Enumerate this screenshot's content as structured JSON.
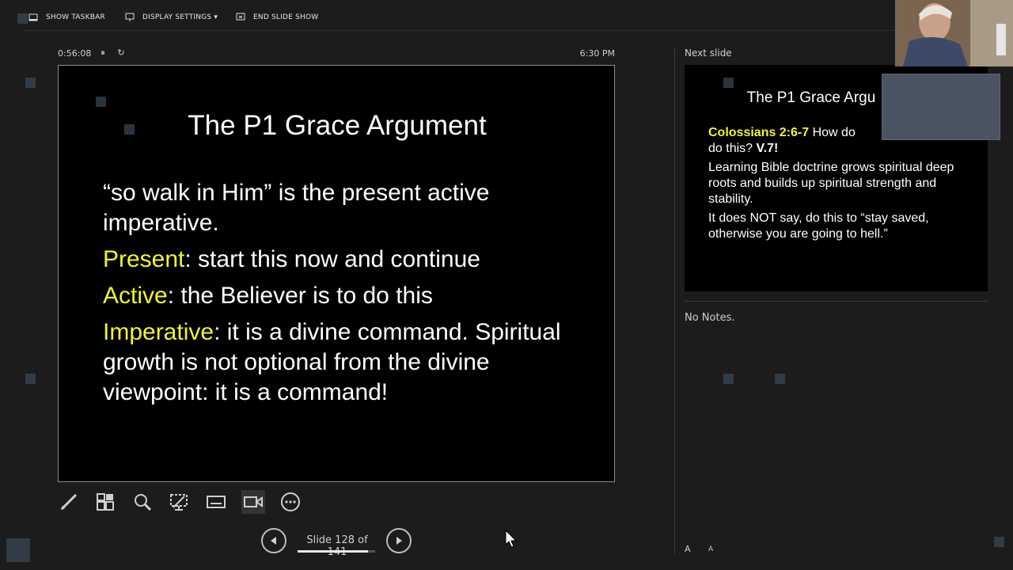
{
  "toolbar": {
    "show_taskbar": "SHOW TASKBAR",
    "display_settings": "DISPLAY SETTINGS ▾",
    "end_slide_show": "END SLIDE SHOW"
  },
  "timer": {
    "elapsed": "0:56:08",
    "pause_icon": "⏸",
    "reset_icon": "↻",
    "clock": "6:30 PM"
  },
  "current_slide": {
    "title": "The P1 Grace Argument",
    "intro": "“so walk in Him” is the present active imperative.",
    "present_term": "Present",
    "present_text": ": start this now and continue",
    "active_term": "Active",
    "active_text": ": the Believer is to do this",
    "imperative_term": "Imperative",
    "imperative_text": ": it is a divine command. Spiritual growth is not optional from the divine viewpoint: it is a command!"
  },
  "navigation": {
    "slide_counter": "Slide 128 of 141",
    "progress_fraction": 0.9078,
    "prev_icon": "◀",
    "next_icon": "▶"
  },
  "next_panel": {
    "label": "Next slide",
    "title": "The P1 Grace Argu",
    "ref": "Colossians 2:6-7",
    "line1": " How do",
    "line1b": "do this? ",
    "v7": "V.7!",
    "para2": "Learning Bible doctrine grows spiritual deep roots and builds up spiritual strength and stability.",
    "para3": "It does NOT say, do this to “stay saved, otherwise you are going to hell.”"
  },
  "notes": {
    "text": "No Notes.",
    "font_increase": "A",
    "font_decrease": "A"
  },
  "icons": [
    "taskbar-icon",
    "display-icon",
    "end-show-icon",
    "pen-icon",
    "slides-grid-icon",
    "zoom-icon",
    "pointer-icon",
    "subtitles-icon",
    "camera-icon",
    "more-icon"
  ],
  "colors": {
    "highlight": "#f2f23a",
    "background": "#1c1c1c",
    "slide_bg": "#000000"
  }
}
